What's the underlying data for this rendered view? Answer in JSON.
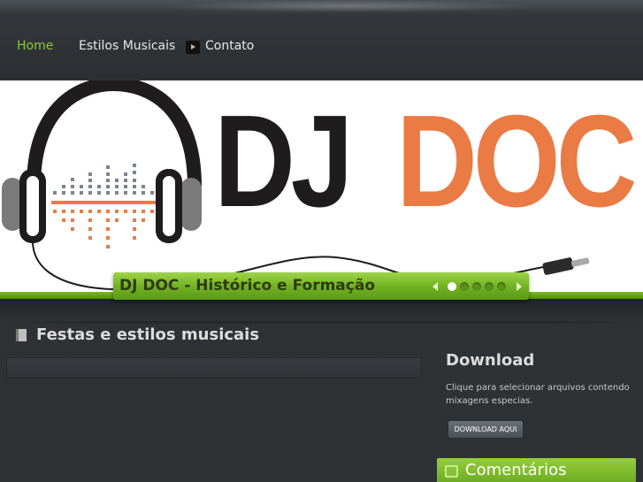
{
  "nav": {
    "items": [
      {
        "label": "Home",
        "active": true
      },
      {
        "label": "Estilos Musicais",
        "active": false
      },
      {
        "label": "Contato",
        "active": false
      }
    ]
  },
  "banner": {
    "logo_left": "DJ",
    "logo_right": "DOC",
    "logo_left_color": "#1e1c1c",
    "logo_right_color": "#ea7b45",
    "caption": "DJ DOC - Histórico e Formação",
    "slides_total": 5,
    "slide_active": 1
  },
  "main": {
    "section_title": "Festas e estilos musicais"
  },
  "sidebar": {
    "download_title": "Download",
    "download_text": "Clique para selecionar arquivos contendo mixagens especias.",
    "download_button": "DOWNLOAD AQUI",
    "comments_title": "Comentários"
  },
  "colors": {
    "accent_green": "#8cc63f",
    "background": "#2e3235"
  }
}
